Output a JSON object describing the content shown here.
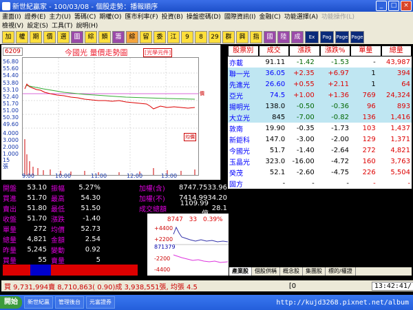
{
  "window": {
    "title": "新世紀贏家 - 100/03/08 - 個股走勢：播報順序"
  },
  "menu": {
    "row1": [
      "畫面(I)",
      "證券(E)",
      "主力(U)",
      "籌碼(C)",
      "期權(O)",
      "匯市利率(F)",
      "投資(B)",
      "操盤密碼(D)",
      "國際資訊(I)",
      "金融(C)",
      "功能選擇(A)",
      "功能操作(L)"
    ],
    "row2": [
      "檢視(V)",
      "設定(S)",
      "工具(T)",
      "說明(H)"
    ]
  },
  "toolbar": [
    "加",
    "權",
    "期",
    "價",
    "選",
    "圖",
    "綜",
    "類",
    "籌",
    "綜",
    "留",
    "委",
    "江",
    "9",
    "8",
    "29",
    "群",
    "興",
    "指",
    "國",
    "陸",
    "成"
  ],
  "toolbar_dark": [
    "Ex",
    "Pag",
    "Page",
    "Page"
  ],
  "chart": {
    "code": "6209",
    "title": "今國光  量價走勢圖",
    "tag": "[光學元件]",
    "yprice": [
      "56.80",
      "55.60",
      "54.40",
      "53.80",
      "53.10",
      "52.40",
      "51.70",
      "51.00",
      "50.30",
      "49.60"
    ],
    "yvol": [
      "4.000",
      "3.000",
      "2.000",
      "1.000",
      "15",
      "45",
      "30",
      "15",
      "張"
    ],
    "xlabels": [
      "9:00",
      "10:00",
      "11:00",
      "12:00",
      "13:00"
    ],
    "tag_vol": "均價",
    "tag_right": "價"
  },
  "table": {
    "headers": [
      "股票別",
      "成交",
      "漲跌",
      "漲跌%",
      "單量",
      "總量"
    ],
    "rows": [
      [
        "亦載",
        "91.11",
        "-1.42",
        "-1.53",
        "-",
        "43,987"
      ],
      [
        "聯一光",
        "36.05",
        "+2.35",
        "+6.97",
        "1",
        "394"
      ],
      [
        "先進光",
        "26.60",
        "+0.55",
        "+2.11",
        "1",
        "64"
      ],
      [
        "亞光",
        "74.5",
        "+1.00",
        "+1.36",
        "769",
        "24,324"
      ],
      [
        "揚明光",
        "138.0",
        "-0.50",
        "-0.36",
        "96",
        "893"
      ],
      [
        "大立光",
        "845",
        "-7.00",
        "-0.82",
        "136",
        "1,416"
      ],
      [
        "敦南",
        "19.90",
        "-0.35",
        "-1.73",
        "103",
        "1,437"
      ],
      [
        "新鉅科",
        "147.0",
        "-3.00",
        "-2.00",
        "129",
        "1,371"
      ],
      [
        "今國光",
        "51.7",
        "-1.40",
        "-2.64",
        "272",
        "4,821"
      ],
      [
        "玉晶光",
        "323.0",
        "-16.00",
        "-4.72",
        "160",
        "3,763"
      ],
      [
        "癸茂",
        "52.1",
        "-2.60",
        "-4.75",
        "226",
        "5,504"
      ],
      [
        "固方",
        "-",
        "-",
        "-",
        "-",
        "-"
      ]
    ]
  },
  "quote": [
    {
      "k": "開盤",
      "v": "53.10",
      "k2": "振幅",
      "v2": "5.27%"
    },
    {
      "k": "買進",
      "v": "51.70",
      "k2": "最高",
      "v2": "54.30"
    },
    {
      "k": "賣出",
      "v": "51.80",
      "k2": "最低",
      "v2": "51.50"
    },
    {
      "k": "收盤",
      "v": "51.70",
      "k2": "漲跌",
      "v2": "-1.40"
    },
    {
      "k": "單量",
      "v": "272",
      "k2": "均價",
      "v2": "52.73"
    },
    {
      "k": "總量",
      "v": "4,821",
      "k2": "金額",
      "v2": "2.54"
    },
    {
      "k": "昨量",
      "v": "5,245",
      "k2": "變動",
      "v2": "0.92"
    },
    {
      "k": "買量",
      "v": "55",
      "k2": "賣量",
      "v2": "5"
    }
  ],
  "index": [
    {
      "k": "加權(含)",
      "v": "8747.75",
      "v3": "33.96"
    },
    {
      "k": "加權(不)",
      "v": "7414.99",
      "v3": "34.20"
    },
    {
      "k": "成交總額",
      "v": "1109.99億",
      "v3": "28.1"
    }
  ],
  "mini": {
    "label": "加權",
    "value": "8747",
    "chg": "33",
    "pct": "0.39%",
    "ylabels": [
      "+4400",
      "+2200",
      "871379",
      "-2200",
      "-4400"
    ]
  },
  "tabs": [
    "產業股",
    "個股供稱",
    "概念股",
    "集團股",
    "標的/權證"
  ],
  "status": {
    "text": "買 9,731,994賣 8,710,863( 0.90)成 3,938,551張, 均張 4.5",
    "bracket": "[0",
    "clock": "13:42:41/"
  },
  "taskbar": {
    "start": "開始",
    "tasks": [
      "新世紀贏",
      "管理後台",
      "元富證券"
    ],
    "url": "http://kujd3268.pixnet.net/album"
  },
  "colors": {
    "bg": "#000000",
    "titlebar": "#245edb",
    "accent": "#d00000"
  }
}
